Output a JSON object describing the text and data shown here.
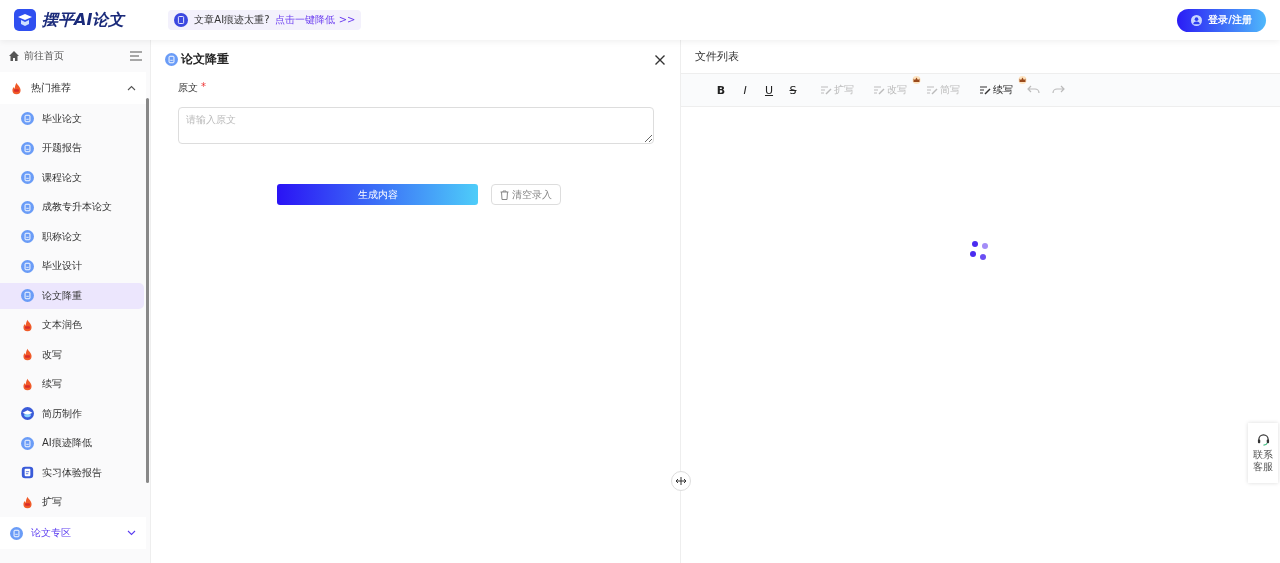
{
  "header": {
    "logo": "摆平AI论文",
    "notice": {
      "text": "文章AI痕迹太重?",
      "link": "点击一键降低 >>"
    },
    "login_button": "登录/注册"
  },
  "sidebar": {
    "home": "前往首页",
    "groups": [
      {
        "label": "热门推荐",
        "kind": "fire",
        "expanded": true,
        "selected": false,
        "items": [
          {
            "label": "毕业论文",
            "kind": "doc",
            "selected": false
          },
          {
            "label": "开题报告",
            "kind": "doc",
            "selected": false
          },
          {
            "label": "课程论文",
            "kind": "doc",
            "selected": false
          },
          {
            "label": "成教专升本论文",
            "kind": "doc",
            "selected": false
          },
          {
            "label": "职称论文",
            "kind": "doc",
            "selected": false
          },
          {
            "label": "毕业设计",
            "kind": "doc",
            "selected": false
          },
          {
            "label": "论文降重",
            "kind": "doc",
            "selected": true
          },
          {
            "label": "文本润色",
            "kind": "fire",
            "selected": false
          },
          {
            "label": "改写",
            "kind": "fire",
            "selected": false
          },
          {
            "label": "续写",
            "kind": "fire",
            "selected": false
          },
          {
            "label": "简历制作",
            "kind": "cap",
            "selected": false
          },
          {
            "label": "AI痕迹降低",
            "kind": "doc",
            "selected": false
          },
          {
            "label": "实习体验报告",
            "kind": "report",
            "selected": false
          },
          {
            "label": "扩写",
            "kind": "fire",
            "selected": false
          }
        ]
      },
      {
        "label": "论文专区",
        "kind": "doc",
        "expanded": false,
        "selected": true
      }
    ]
  },
  "form": {
    "title": "论文降重",
    "field_label": "原文",
    "required_mark": "*",
    "placeholder": "请输入原文",
    "generate_button": "生成内容",
    "clear_button": "清空录入"
  },
  "editor": {
    "title": "文件列表",
    "toolbar": [
      {
        "kind": "format",
        "label": "B"
      },
      {
        "kind": "format",
        "label": "I"
      },
      {
        "kind": "format",
        "label": "U"
      },
      {
        "kind": "format",
        "label": "S"
      },
      {
        "kind": "action",
        "label": "扩写",
        "disabled": true,
        "premium": false
      },
      {
        "kind": "action",
        "label": "改写",
        "disabled": true,
        "premium": true
      },
      {
        "kind": "action",
        "label": "简写",
        "disabled": true,
        "premium": false
      },
      {
        "kind": "action",
        "label": "续写",
        "disabled": false,
        "premium": true
      },
      {
        "kind": "undo",
        "disabled": true
      },
      {
        "kind": "redo",
        "disabled": true
      }
    ]
  },
  "support": {
    "label": "联系客服"
  }
}
